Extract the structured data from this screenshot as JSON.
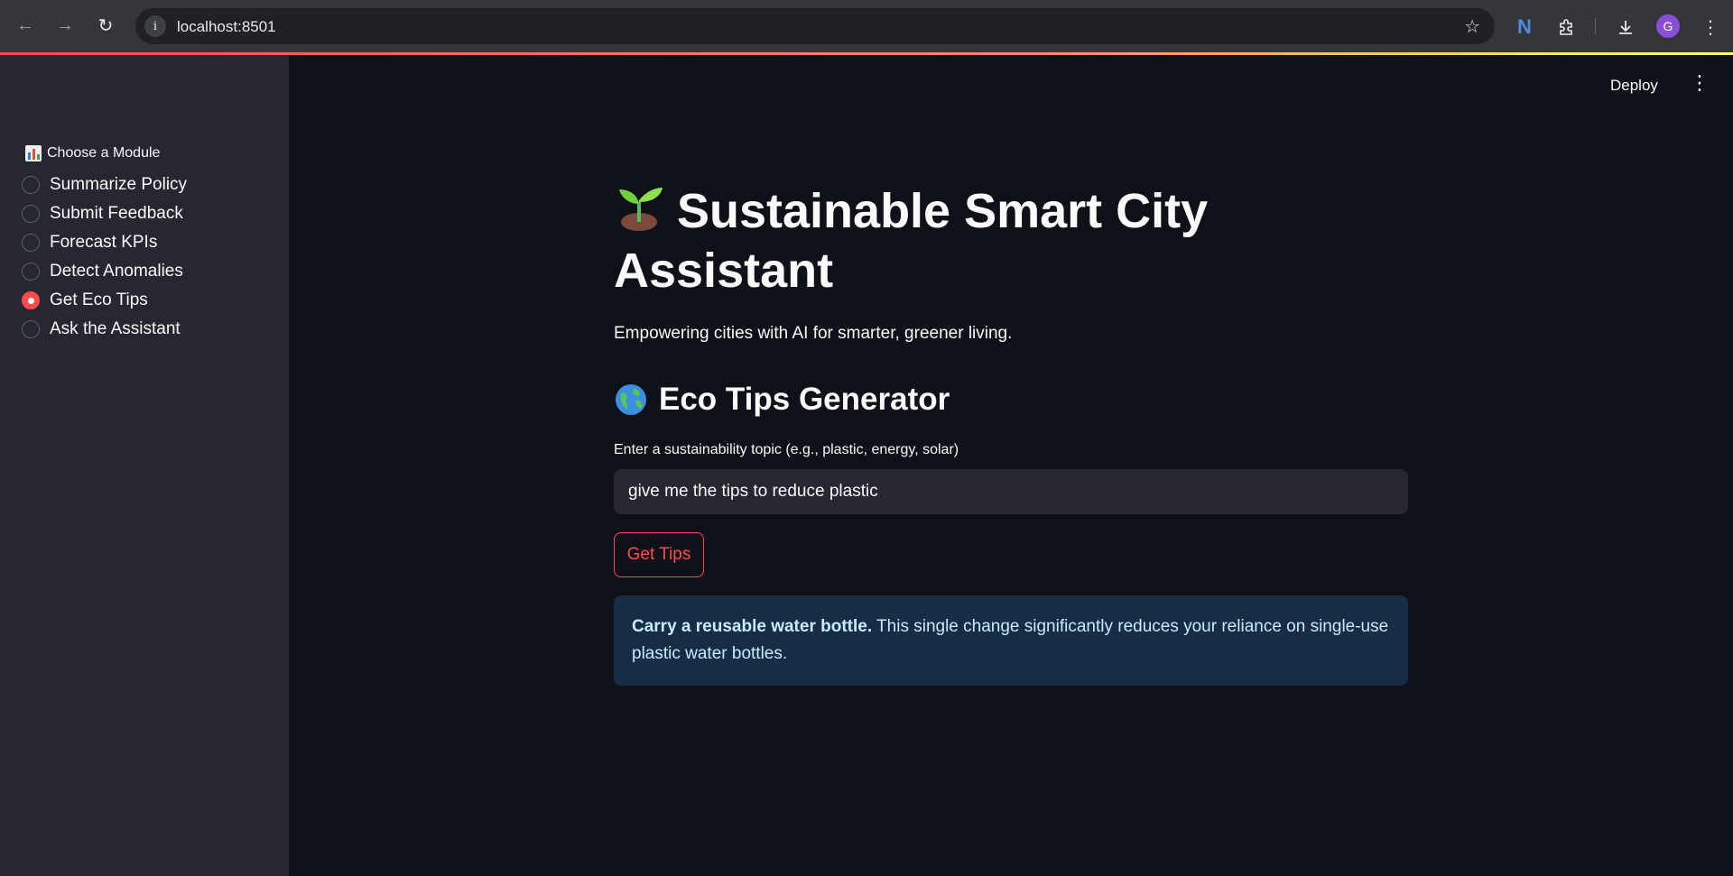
{
  "browser": {
    "url": "localhost:8501",
    "avatar_initial": "G",
    "icons": [
      "back-icon",
      "forward-icon",
      "reload-icon",
      "site-info-icon",
      "bookmark-star-icon",
      "extension-n-icon",
      "extensions-puzzle-icon",
      "download-icon",
      "more-vert-icon"
    ]
  },
  "sidebar": {
    "module_label": "Choose a Module",
    "options": [
      {
        "label": "Summarize Policy",
        "checked": false
      },
      {
        "label": "Submit Feedback",
        "checked": false
      },
      {
        "label": "Forecast KPIs",
        "checked": false
      },
      {
        "label": "Detect Anomalies",
        "checked": false
      },
      {
        "label": "Get Eco Tips",
        "checked": true
      },
      {
        "label": "Ask the Assistant",
        "checked": false
      }
    ]
  },
  "header": {
    "deploy_label": "Deploy"
  },
  "main": {
    "title": "Sustainable Smart City Assistant",
    "subtitle": "Empowering cities with AI for smarter, greener living.",
    "section_title": "Eco Tips Generator",
    "input_label": "Enter a sustainability topic (e.g., plastic, energy, solar)",
    "input_value": "give me the tips to reduce plastic",
    "button_label": "Get Tips",
    "tip_bold": "Carry a reusable water bottle.",
    "tip_text": " This single change significantly reduces your reliance on single-use plastic water bottles."
  },
  "colors": {
    "accent": "#ff4b4b",
    "background": "#0e1117",
    "sidebar": "#262730",
    "info_bg": "#172d43",
    "info_text": "#c7ebff"
  }
}
